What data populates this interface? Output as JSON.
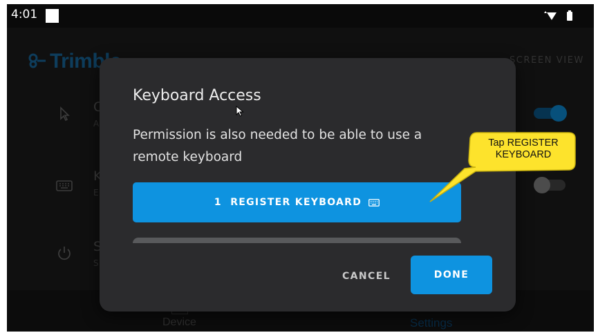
{
  "status_bar": {
    "time": "4:01",
    "icons": [
      "wifi-icon",
      "battery-icon"
    ]
  },
  "header": {
    "logo_text": "Trimble",
    "screen_view_label": "SCREEN VIEW"
  },
  "settings_rows": [
    {
      "icon": "cursor-icon",
      "title": "C",
      "subtitle": "A",
      "toggle_on": true
    },
    {
      "icon": "keyboard-icon",
      "title": "K",
      "subtitle": "E",
      "toggle_on": false
    },
    {
      "icon": "power-icon",
      "title": "S",
      "subtitle": "S"
    }
  ],
  "bottom_nav": {
    "device_label": "Device",
    "settings_label": "Settings"
  },
  "dialog": {
    "title": "Keyboard Access",
    "message": "Permission is also needed to be able to use a remote keyboard",
    "register_button_label": "1  REGISTER KEYBOARD",
    "cancel_label": "CANCEL",
    "done_label": "DONE"
  },
  "callout": {
    "text": "Tap REGISTER KEYBOARD"
  },
  "colors": {
    "accent": "#0e93e0",
    "dialog_bg": "#2b2b2d",
    "screen_bg": "#1e1e1e",
    "callout_bg": "#fde32c",
    "toggle_on": "#0e93e0"
  }
}
